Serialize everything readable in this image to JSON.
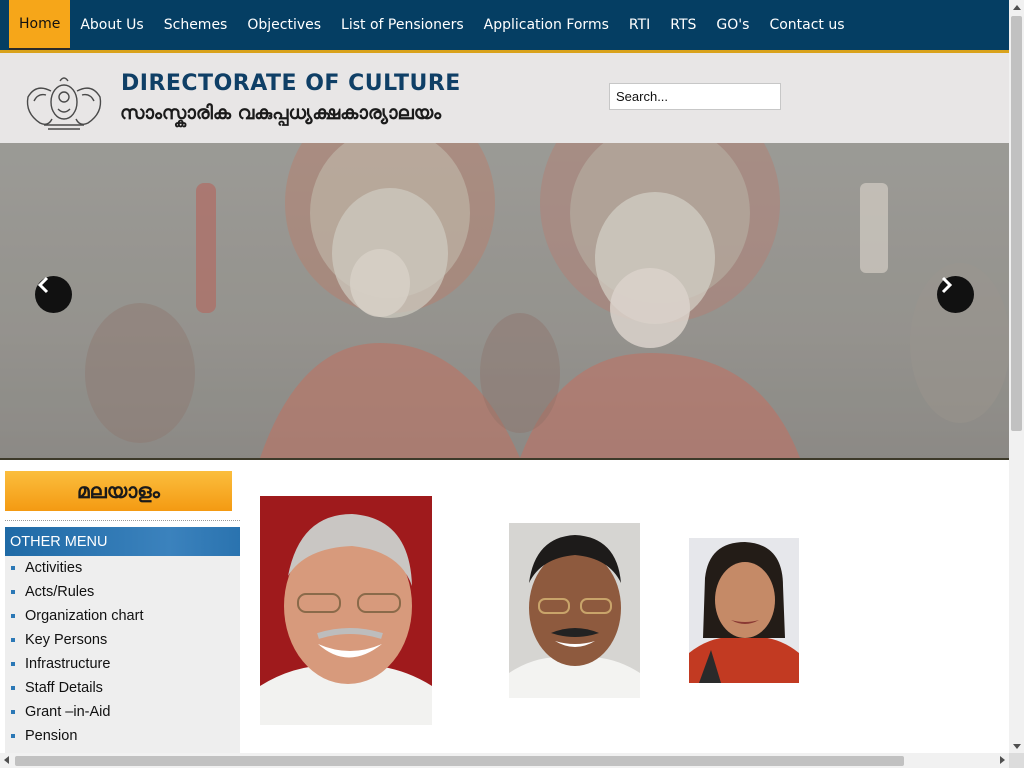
{
  "nav": {
    "items": [
      "Home",
      "About Us",
      "Schemes",
      "Objectives",
      "List of Pensioners",
      "Application Forms",
      "RTI",
      "RTS",
      "GO's",
      "Contact us"
    ],
    "active": "Home"
  },
  "header": {
    "title": "DIRECTORATE OF CULTURE",
    "subtitle": "സാംസ്കാരിക വകുപ്പധ്യക്ഷകാര്യാലയം",
    "search_value": "Search..."
  },
  "slider": {
    "prev_icon": "chevron-left-icon",
    "next_icon": "chevron-right-icon"
  },
  "sidebar": {
    "language_button": "മലയാളം",
    "menu_title": "OTHER MENU",
    "items": [
      "Activities",
      "Acts/Rules",
      "Organization chart",
      "Key Persons",
      "Infrastructure",
      "Staff Details",
      "Grant –in-Aid",
      "Pension"
    ]
  },
  "colors": {
    "nav_bg": "#053e63",
    "accent": "#f6a619",
    "menu_head": "#2a73af"
  }
}
